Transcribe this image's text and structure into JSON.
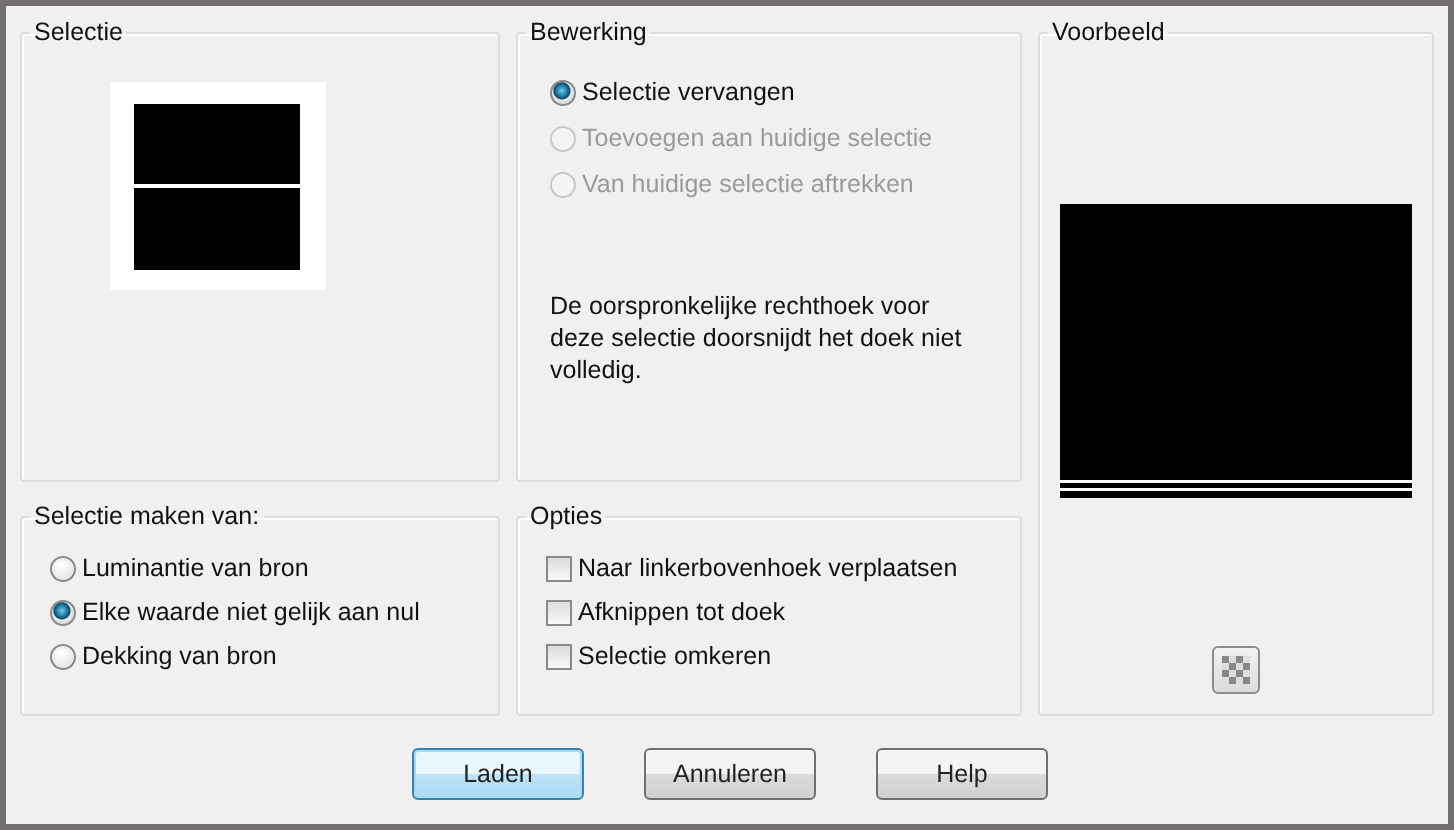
{
  "selection_group": {
    "title": "Selectie"
  },
  "operation_group": {
    "title": "Bewerking",
    "options": [
      {
        "label": "Selectie vervangen",
        "selected": true,
        "disabled": false
      },
      {
        "label": "Toevoegen aan huidige selectie",
        "selected": false,
        "disabled": true
      },
      {
        "label": "Van huidige selectie aftrekken",
        "selected": false,
        "disabled": true
      }
    ],
    "message": "De oorspronkelijke rechthoek voor deze selectie doorsnijdt het doek niet volledig."
  },
  "preview_group": {
    "title": "Voorbeeld"
  },
  "source_group": {
    "title": "Selectie maken van:",
    "options": [
      {
        "label": "Luminantie van bron",
        "selected": false,
        "disabled": false
      },
      {
        "label": "Elke waarde niet gelijk aan nul",
        "selected": true,
        "disabled": false
      },
      {
        "label": "Dekking van bron",
        "selected": false,
        "disabled": false
      }
    ]
  },
  "options_group": {
    "title": "Opties",
    "options": [
      {
        "label": "Naar linkerbovenhoek verplaatsen",
        "checked": false
      },
      {
        "label": "Afknippen tot doek",
        "checked": false
      },
      {
        "label": "Selectie omkeren",
        "checked": false
      }
    ]
  },
  "buttons": [
    {
      "label": "Laden",
      "kind": "default"
    },
    {
      "label": "Annuleren",
      "kind": "normal"
    },
    {
      "label": "Help",
      "kind": "normal"
    }
  ]
}
